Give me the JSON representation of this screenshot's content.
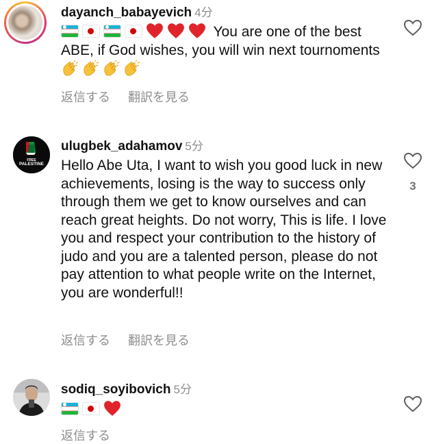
{
  "comments": [
    {
      "username": "dayanch_babayevich",
      "timestamp": "4分",
      "emoji_prefix": [
        "flag-uz",
        "flag-jp",
        "flag-uz",
        "flag-jp",
        "red-heart",
        "red-heart",
        "red-heart"
      ],
      "text_line1": "You are one of the",
      "text_rest": "best ABE, if God wishes, you will win next tournoments",
      "emoji_suffix": [
        "clapping-hands",
        "clapping-hands",
        "clapping-hands",
        "clapping-hands"
      ],
      "reply_label": "返信する",
      "translate_label": "翻訳を見る",
      "like_count": ""
    },
    {
      "username": "ulugbek_adahamov",
      "timestamp": "5分",
      "avatar_text_top": "FREE",
      "avatar_text_bottom": "PALESTINE",
      "text": "Hello Abe Uta, I want to wish you good luck in new achievements, losing is the way to success only through them we get to know ourselves and can reach great heights. Do not worry, This is life. I love you and respect your contribution to the history of judo and you are a talented person, please do not pay attention to what people write on the Internet, you are wonderful!!",
      "reply_label": "返信する",
      "translate_label": "翻訳を見る",
      "like_count": "3"
    },
    {
      "username": "sodiq_soyibovich",
      "timestamp": "5分",
      "emoji_prefix": [
        "flag-uz",
        "flag-jp",
        "red-heart"
      ],
      "reply_label": "返信する",
      "like_count": ""
    }
  ],
  "colors": {
    "text": "#111111",
    "secondary": "#8e8e8e",
    "heart_red": "#e0242b"
  }
}
